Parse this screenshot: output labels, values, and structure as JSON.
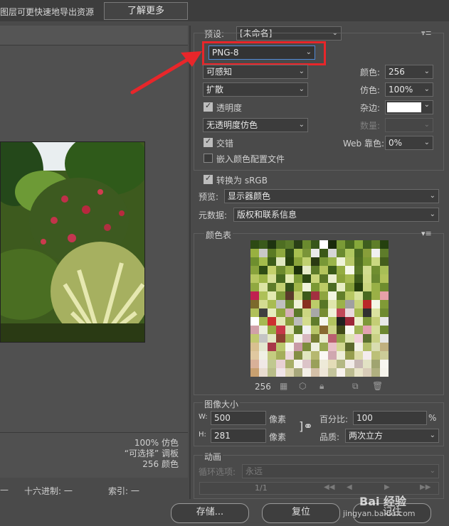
{
  "topbar": {
    "hint": "图层可更快速地导出资源",
    "learn_more": "了解更多"
  },
  "preset": {
    "label": "预设:",
    "value": "[未命名]"
  },
  "format": {
    "value": "PNG-8"
  },
  "reduction": {
    "value": "可感知"
  },
  "dither_algo": {
    "value": "扩散"
  },
  "colors": {
    "label": "颜色:",
    "value": "256"
  },
  "dither": {
    "label": "仿色:",
    "value": "100%"
  },
  "transparency": {
    "label": "透明度",
    "checked": true
  },
  "matte": {
    "label": "杂边:",
    "color": "#ffffff"
  },
  "trans_dither": {
    "value": "无透明度仿色"
  },
  "amount": {
    "label": "数量:",
    "value": ""
  },
  "interlaced": {
    "label": "交错",
    "checked": true
  },
  "web_snap": {
    "label": "Web 靠色:",
    "value": "0%"
  },
  "embed_profile": {
    "label": "嵌入颜色配置文件",
    "checked": false
  },
  "convert_srgb": {
    "label": "转换为 sRGB",
    "checked": true
  },
  "preview": {
    "label": "预览:",
    "value": "显示器颜色"
  },
  "metadata": {
    "label": "元数据:",
    "value": "版权和联系信息"
  },
  "color_table": {
    "title": "颜色表",
    "count": "256"
  },
  "image_size": {
    "title": "图像大小",
    "w_label": "W:",
    "w_value": "500",
    "h_label": "H:",
    "h_value": "281",
    "unit": "像素",
    "percent_label": "百分比:",
    "percent_value": "100",
    "percent_unit": "%",
    "quality_label": "品质:",
    "quality_value": "两次立方"
  },
  "animation": {
    "title": "动画",
    "loop_label": "循环选项:",
    "loop_value": "永远",
    "frame": "1/1"
  },
  "info": {
    "dither": "100% 仿色",
    "selective": "“可选择” 调板",
    "colors": "256 颜色"
  },
  "statusbar": {
    "hex": "十六进制: 一",
    "index": "索引: 一"
  },
  "buttons": {
    "save": "存储...",
    "reset": "复位",
    "remember": "记住"
  },
  "watermark": {
    "site": "jingyan.baidu.com",
    "brand": "Bai 经验"
  },
  "annotation": {
    "highlight_color": "#e8262a"
  },
  "swatches": [
    "#2d4a14",
    "#3a5a1c",
    "#1e3410",
    "#4e6e22",
    "#5a7a2a",
    "#2a4016",
    "#6a8a2e",
    "#36561a",
    "#ffffff",
    "#1a2a0c",
    "#7a9a36",
    "#4a6a20",
    "#86a83a",
    "#3e5e1e",
    "#5e7e28",
    "#24400e",
    "#98b040",
    "#c8c8c8",
    "#5a7a24",
    "#8ea83e",
    "#2e4a16",
    "#a8c050",
    "#7a9438",
    "#eaeaea",
    "#3a5818",
    "#d6d6d6",
    "#6a8a30",
    "#b0c860",
    "#4a6a22",
    "#889e3a",
    "#f0f0f0",
    "#5e7c2a",
    "#6e8e2e",
    "#a4bc4c",
    "#3c5c1a",
    "#e0e8c0",
    "#28420e",
    "#8aa43a",
    "#c0d070",
    "#2a3a12",
    "#789836",
    "#9ab44a",
    "#eef2d8",
    "#b8c868",
    "#506e22",
    "#7c9a34",
    "#cad880",
    "#445e1c",
    "#88a23c",
    "#2e4c14",
    "#c4d06c",
    "#6c8a2e",
    "#a0b84c",
    "#1c300a",
    "#e6ecc8",
    "#5c7a28",
    "#b4c45c",
    "#3a5a18",
    "#94ac42",
    "#f6f8e8",
    "#567426",
    "#d2dc90",
    "#708e30",
    "#a8be56",
    "#b6c660",
    "#9cb446",
    "#d8e09a",
    "#486a20",
    "#e4ecb4",
    "#7e9c36",
    "#2c4812",
    "#c8d478",
    "#5a7626",
    "#ecf0d0",
    "#8aa23a",
    "#a6ba50",
    "#3e5a1a",
    "#d0da88",
    "#6a8830",
    "#b2c25a",
    "#90a840",
    "#dce4a4",
    "#5e7c2a",
    "#c2d072",
    "#34521a",
    "#a0b648",
    "#f0f4dc",
    "#7a9834",
    "#bccb66",
    "#4c6c22",
    "#e8eec4",
    "#86a03a",
    "#263e0c",
    "#cad67e",
    "#98b046",
    "#6e8c2e",
    "#c02050",
    "#aec058",
    "#e2eab0",
    "#7c9a38",
    "#5a3a2a",
    "#c6d276",
    "#3c5a1a",
    "#a23040",
    "#8ea440",
    "#f2f4e0",
    "#627e2a",
    "#b8c862",
    "#d8e29c",
    "#4a6a20",
    "#9ab046",
    "#e6a0a8",
    "#7c6a2c",
    "#d4dc92",
    "#a8bc52",
    "#c0c0c0",
    "#6a8a2e",
    "#eef2d6",
    "#883020",
    "#bccc6a",
    "#587626",
    "#e0e6ac",
    "#9cb24a",
    "#a0a0a0",
    "#c8d47a",
    "#ba2828",
    "#f4f6e6",
    "#809a36",
    "#b0c05a",
    "#404040",
    "#e6ecbe",
    "#90a640",
    "#d6b0b8",
    "#5c7828",
    "#ccd682",
    "#a8a8a8",
    "#768c32",
    "#f0f2da",
    "#c04858",
    "#e8d8dc",
    "#a4b84e",
    "#303030",
    "#dae2a0",
    "#6e8a30",
    "#ffffff",
    "#a6ba52",
    "#cc3030",
    "#e2e8b6",
    "#8a9e3c",
    "#bcbcbc",
    "#d4dc8e",
    "#607c2c",
    "#f6f6f0",
    "#b2c460",
    "#202020",
    "#9c2838",
    "#ecf0cc",
    "#7e983a",
    "#c4ce76",
    "#e8e8e8",
    "#d0a0a8",
    "#eaeedc",
    "#98ac44",
    "#c63848",
    "#e0e6b8",
    "#5e7a2a",
    "#f2f2f2",
    "#b8c66a",
    "#886830",
    "#ccd488",
    "#404a18",
    "#f8f8f0",
    "#a0b454",
    "#e2a2b0",
    "#d6de9a",
    "#6c8632",
    "#c0c870",
    "#c4c4c4",
    "#e4e8c4",
    "#8c4030",
    "#a8b85a",
    "#f4f4ea",
    "#d8b8c0",
    "#767e34",
    "#e8eccc",
    "#ba6070",
    "#90a44a",
    "#dee4b2",
    "#f0d0d8",
    "#5a7030",
    "#c8d084",
    "#e6e6e6",
    "#d8c090",
    "#e4e8d0",
    "#a83848",
    "#bac86e",
    "#f6f6ee",
    "#c89aa6",
    "#7c8c3c",
    "#eef0e0",
    "#98a852",
    "#e8c0c8",
    "#d2d892",
    "#5c6a2c",
    "#f2f2e6",
    "#b0bc66",
    "#d8dcb0",
    "#c0b080",
    "#e0c8a0",
    "#f0f0e4",
    "#c4cc80",
    "#a4ae5a",
    "#ecd8dc",
    "#848e44",
    "#e2e6c0",
    "#b6b870",
    "#faf8f4",
    "#d0a8b0",
    "#eeeed8",
    "#969e4e",
    "#dcdca8",
    "#f4ecee",
    "#bcc078",
    "#cccc98",
    "#d8b098",
    "#f0e8e6",
    "#c0c890",
    "#e8d0d4",
    "#a8ae68",
    "#f6f4ee",
    "#dcc4c8",
    "#9aa05a",
    "#eeead8",
    "#e4dcb8",
    "#b4b884",
    "#f2ece8",
    "#c8b8b4",
    "#e2e2c4",
    "#a0a470",
    "#f8f6f0",
    "#c8a070",
    "#e8dcd0",
    "#b8bc88",
    "#f0e4e8",
    "#dcd4b0",
    "#a8a87c",
    "#f4f0e8",
    "#d4c0a8",
    "#eee6d8",
    "#c4c49c",
    "#f8f2ee",
    "#bcbc90",
    "#e8e4c8",
    "#d8ccb8",
    "#b0b080",
    "#f6f4ec"
  ]
}
